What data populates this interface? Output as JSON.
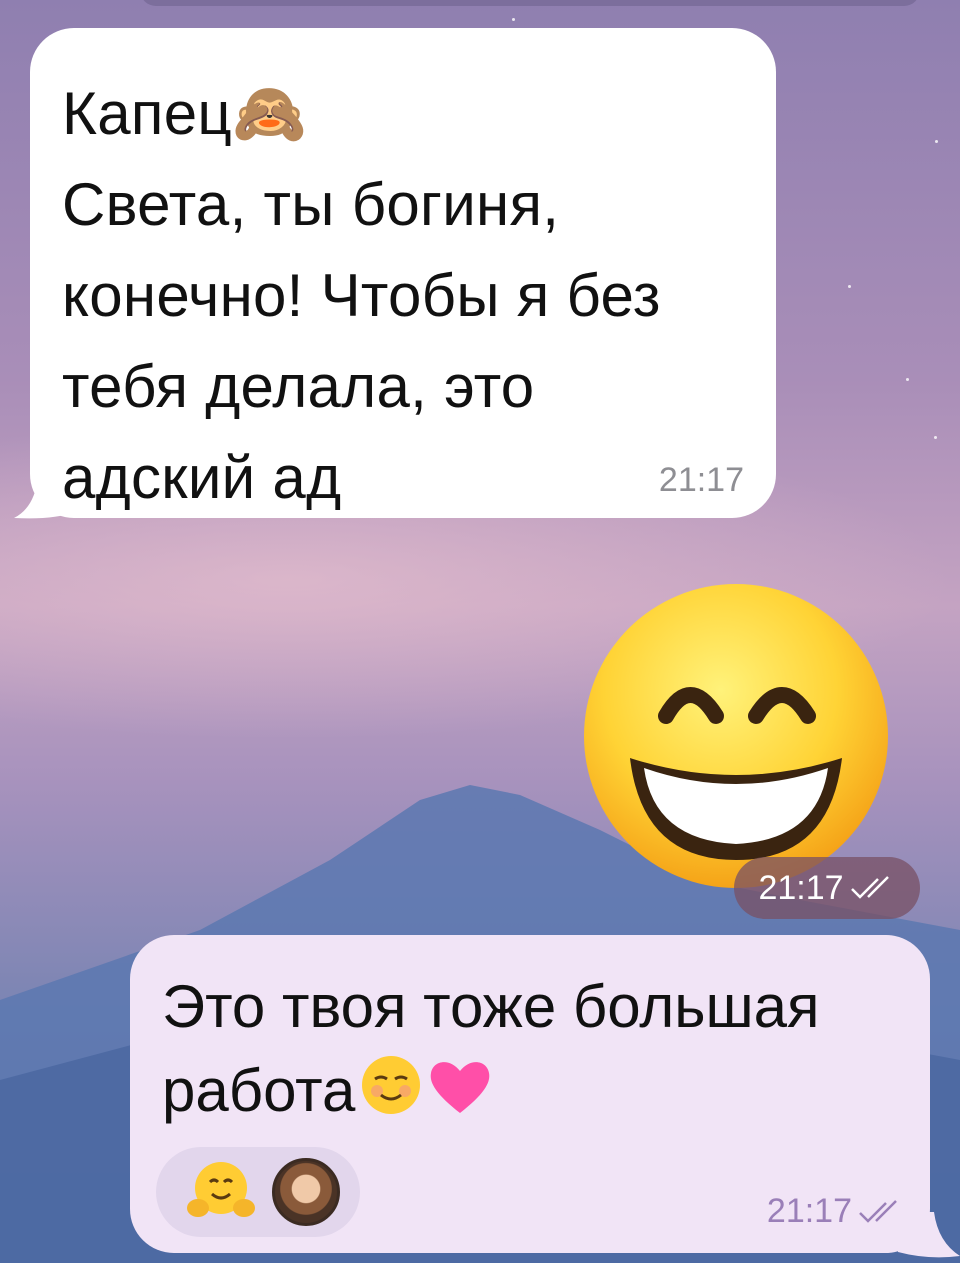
{
  "messages": {
    "incoming": {
      "text": "Капец🙈\nСвета, ты богиня,\nконечно! Чтобы я без\nтебя делала, это\nадский ад",
      "time": "21:17"
    },
    "sticker": {
      "emoji_name": "grinning-face-with-smiling-eyes",
      "time": "21:17"
    },
    "outgoing": {
      "text": "Это твоя тоже большая работа",
      "time": "21:17",
      "inline_emojis": [
        "smiling-face-icon",
        "heart-icon"
      ],
      "reactions": [
        "hugging-face-icon",
        "avatar"
      ]
    }
  },
  "colors": {
    "incoming_bubble": "#ffffff",
    "outgoing_bubble": "#f1e4f6",
    "timestamp_out": "#9a7fb8"
  }
}
